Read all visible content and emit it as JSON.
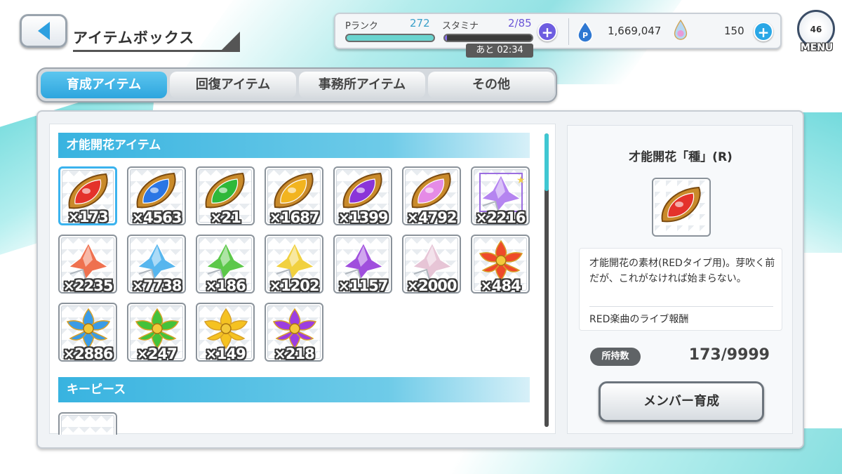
{
  "header": {
    "title": "アイテムボックス",
    "rank_label": "Pランク",
    "rank_value": "272",
    "stamina_label": "スタミナ",
    "stamina_value": "2/85",
    "stamina_fraction": 0.0235,
    "timer": "あと 02:34",
    "currency1": "1,669,047",
    "currency2": "150",
    "menu_badge": "46",
    "menu_label": "MENU"
  },
  "tabs": [
    {
      "label": "育成アイテム",
      "active": true
    },
    {
      "label": "回復アイテム",
      "active": false
    },
    {
      "label": "事務所アイテム",
      "active": false
    },
    {
      "label": "その他",
      "active": false
    }
  ],
  "sections": [
    {
      "title": "才能開花アイテム"
    },
    {
      "title": "キーピース"
    }
  ],
  "items": [
    {
      "qty": "×173",
      "icon": "seed-red",
      "color": "#e4322b"
    },
    {
      "qty": "×4563",
      "icon": "seed-blue",
      "color": "#2b76e4"
    },
    {
      "qty": "×21",
      "icon": "seed-green",
      "color": "#2fb83a"
    },
    {
      "qty": "×1687",
      "icon": "seed-yellow",
      "color": "#f2b41f"
    },
    {
      "qty": "×1399",
      "icon": "seed-purple",
      "color": "#8a35d8"
    },
    {
      "qty": "×4792",
      "icon": "seed-rainbow",
      "color": "#e58be6"
    },
    {
      "qty": "×2216",
      "icon": "crystal-purple-star",
      "color": "#b27ff0"
    },
    {
      "qty": "×2235",
      "icon": "bud-red",
      "color": "#ef6a46"
    },
    {
      "qty": "×7738",
      "icon": "bud-blue",
      "color": "#4fb3ee"
    },
    {
      "qty": "×186",
      "icon": "bud-green",
      "color": "#55c641"
    },
    {
      "qty": "×1202",
      "icon": "bud-yellow",
      "color": "#f1cf36"
    },
    {
      "qty": "×1157",
      "icon": "bud-purple",
      "color": "#9b46dc"
    },
    {
      "qty": "×2000",
      "icon": "bud-rainbow",
      "color": "#e6c2d4"
    },
    {
      "qty": "×484",
      "icon": "flower-red",
      "color": "#ee4a2a"
    },
    {
      "qty": "×2886",
      "icon": "flower-blue",
      "color": "#3a9be6"
    },
    {
      "qty": "×247",
      "icon": "flower-green",
      "color": "#44c23a"
    },
    {
      "qty": "×149",
      "icon": "flower-yellow",
      "color": "#f5c221"
    },
    {
      "qty": "×218",
      "icon": "flower-purple",
      "color": "#9c3ee0"
    }
  ],
  "detail": {
    "name": "才能開花「種」(R)",
    "description": "才能開花の素材(REDタイプ用)。芽吹く前だが、これがなければ始まらない。",
    "source": "RED楽曲のライブ報酬",
    "owned_label": "所持数",
    "owned_value": "173/9999",
    "button_label": "メンバー育成"
  }
}
